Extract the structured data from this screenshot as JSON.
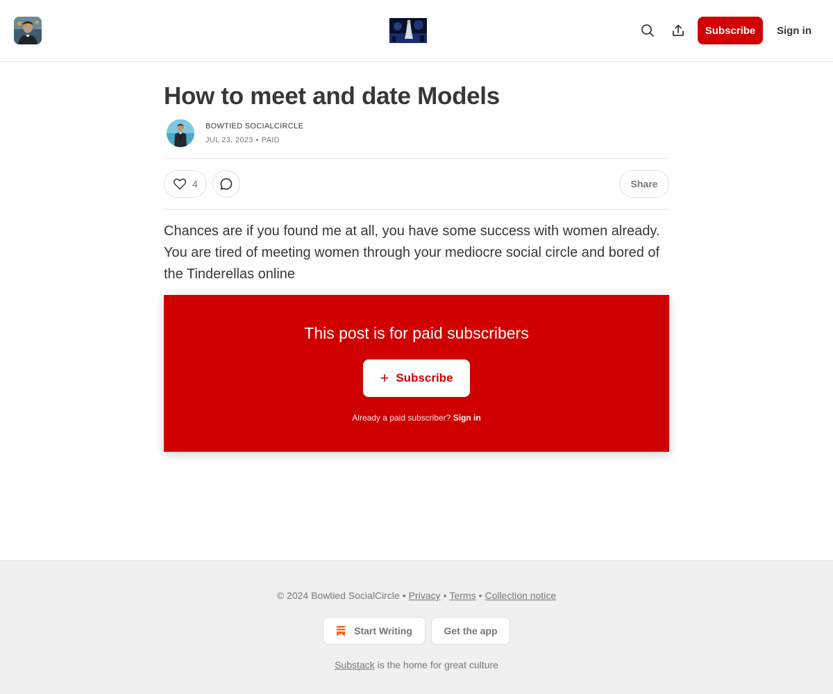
{
  "header": {
    "subscribe_label": "Subscribe",
    "signin_label": "Sign in",
    "icons": [
      "search-icon",
      "share-icon"
    ]
  },
  "post": {
    "title": "How to meet and date Models",
    "author": "BOWTIED SOCIALCIRCLE",
    "date": "JUL 23, 2023",
    "access": "PAID",
    "likes": "4",
    "share_label": "Share",
    "body": "Chances are if you found me at all, you have some success with women already. You are tired of meeting women through your mediocre social circle and bored of the Tinderellas online"
  },
  "paywall": {
    "title": "This post is for paid subscribers",
    "button_label": "Subscribe",
    "note": "Already a paid subscriber?",
    "signin_label": "Sign in"
  },
  "footer": {
    "copyright": "© 2024 Bowtied SocialCircle",
    "privacy": "Privacy",
    "terms": "Terms",
    "collection": "Collection notice",
    "start_writing": "Start Writing",
    "get_app": "Get the app",
    "substack": "Substack",
    "tagline": "is the home for great culture"
  },
  "colors": {
    "accent": "#d10000",
    "text": "#363737",
    "muted": "#777777",
    "footer_bg": "#f0f0f0",
    "bookmark": "#ff6719"
  }
}
